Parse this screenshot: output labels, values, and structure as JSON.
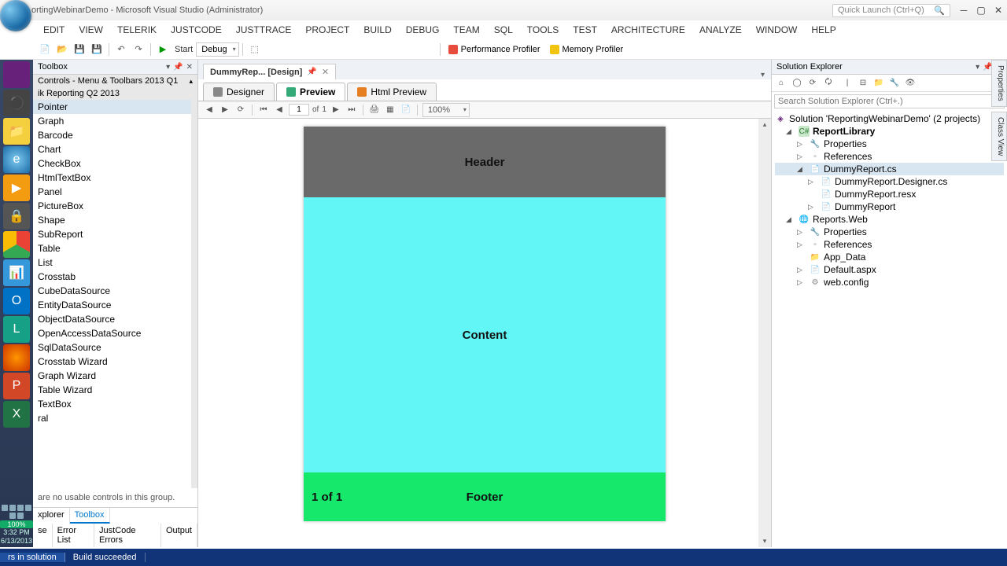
{
  "title": "ortingWebinarDemo - Microsoft Visual Studio (Administrator)",
  "quickLaunch": "Quick Launch (Ctrl+Q)",
  "menu": [
    "EDIT",
    "VIEW",
    "TELERIK",
    "JUSTCODE",
    "JUSTTRACE",
    "PROJECT",
    "BUILD",
    "DEBUG",
    "TEAM",
    "SQL",
    "TOOLS",
    "TEST",
    "ARCHITECTURE",
    "ANALYZE",
    "WINDOW",
    "HELP"
  ],
  "toolbar": {
    "start": "Start",
    "config": "Debug",
    "perf": "Performance Profiler",
    "mem": "Memory Profiler"
  },
  "toolbox": {
    "title": "Toolbox",
    "group1": "Controls - Menu & Toolbars 2013 Q1",
    "group2": "ik Reporting Q2 2013",
    "items": [
      "Pointer",
      "Graph",
      "Barcode",
      "Chart",
      "CheckBox",
      "HtmlTextBox",
      "Panel",
      "PictureBox",
      "Shape",
      "SubReport",
      "Table",
      "List",
      "Crosstab",
      "CubeDataSource",
      "EntityDataSource",
      "ObjectDataSource",
      "OpenAccessDataSource",
      "SqlDataSource",
      "Crosstab Wizard",
      "Graph Wizard",
      "Table Wizard",
      "TextBox",
      "ral"
    ],
    "msg": " are no usable controls in this group.",
    "tabs": [
      "xplorer",
      "Toolbox"
    ],
    "bottomTabs": [
      "se",
      "Error List",
      "JustCode Errors",
      "Output"
    ]
  },
  "docTab": "DummyRep... [Design]",
  "viewTabs": {
    "designer": "Designer",
    "preview": "Preview",
    "html": "Html Preview"
  },
  "previewTb": {
    "page": "1",
    "of": "of",
    "total": "1",
    "zoom": "100%"
  },
  "report": {
    "header": "Header",
    "content": "Content",
    "footer": "Footer",
    "pageOf": "1 of 1"
  },
  "solution": {
    "title": "Solution Explorer",
    "search": "Search Solution Explorer (Ctrl+.)",
    "root": "Solution 'ReportingWebinarDemo' (2 projects)",
    "p1": "ReportLibrary",
    "props": "Properties",
    "refs": "References",
    "dummy": "DummyReport.cs",
    "dummyD": "DummyReport.Designer.cs",
    "dummyR": "DummyReport.resx",
    "dummyC": "DummyReport",
    "p2": "Reports.Web",
    "appdata": "App_Data",
    "defaspx": "Default.aspx",
    "webcfg": "web.config"
  },
  "rightTabs": [
    "Properties",
    "Class View"
  ],
  "status": {
    "left": "rs in solution",
    "build": "Build succeeded"
  },
  "clock": {
    "time": "3:32 PM",
    "date": "6/13/2013"
  }
}
